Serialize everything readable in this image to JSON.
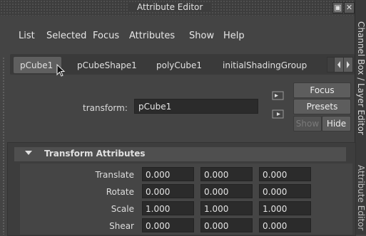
{
  "window": {
    "title": "Attribute Editor"
  },
  "menubar": [
    "List",
    "Selected",
    "Focus",
    "Attributes",
    "Show",
    "Help"
  ],
  "tabs": [
    "pCube1",
    "pCubeShape1",
    "polyCube1",
    "initialShadingGroup"
  ],
  "active_tab": "pCube1",
  "side_panels": {
    "channel_box": "Channel Box / Layer Editor",
    "attribute_editor": "Attribute Editor"
  },
  "node": {
    "type_label": "transform:",
    "name": "pCube1"
  },
  "buttons": {
    "focus": "Focus",
    "presets": "Presets",
    "show": "Show",
    "hide": "Hide"
  },
  "section": {
    "title": "Transform Attributes",
    "rows": [
      {
        "label": "Translate",
        "values": [
          "0.000",
          "0.000",
          "0.000"
        ]
      },
      {
        "label": "Rotate",
        "values": [
          "0.000",
          "0.000",
          "0.000"
        ]
      },
      {
        "label": "Scale",
        "values": [
          "1.000",
          "1.000",
          "1.000"
        ]
      },
      {
        "label": "Shear",
        "values": [
          "0.000",
          "0.000",
          "0.000"
        ]
      }
    ]
  },
  "colors": {
    "background": "#444444",
    "field": "#2b2b2b",
    "button": "#5d5d5d"
  }
}
